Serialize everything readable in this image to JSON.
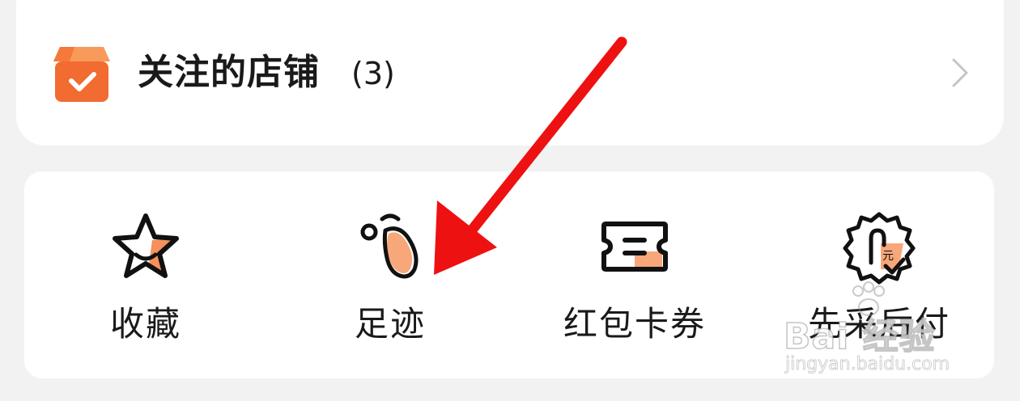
{
  "followed_shops": {
    "title": "关注的店铺",
    "count": "(3)",
    "icon": "shop-check-icon",
    "chevron_icon": "chevron-right-icon"
  },
  "quick_actions": [
    {
      "label": "收藏",
      "icon": "star-icon"
    },
    {
      "label": "足迹",
      "icon": "footprint-icon"
    },
    {
      "label": "红包卡券",
      "icon": "coupon-icon"
    },
    {
      "label": "先采后付",
      "icon": "pay-later-badge-icon"
    }
  ],
  "colors": {
    "accent_orange": "#f5793a",
    "accent_light": "#f7a77a",
    "annotation_arrow": "#ee1111"
  },
  "watermark": {
    "brand": "Bai 经验",
    "site": "jingyan.baidu.com"
  }
}
